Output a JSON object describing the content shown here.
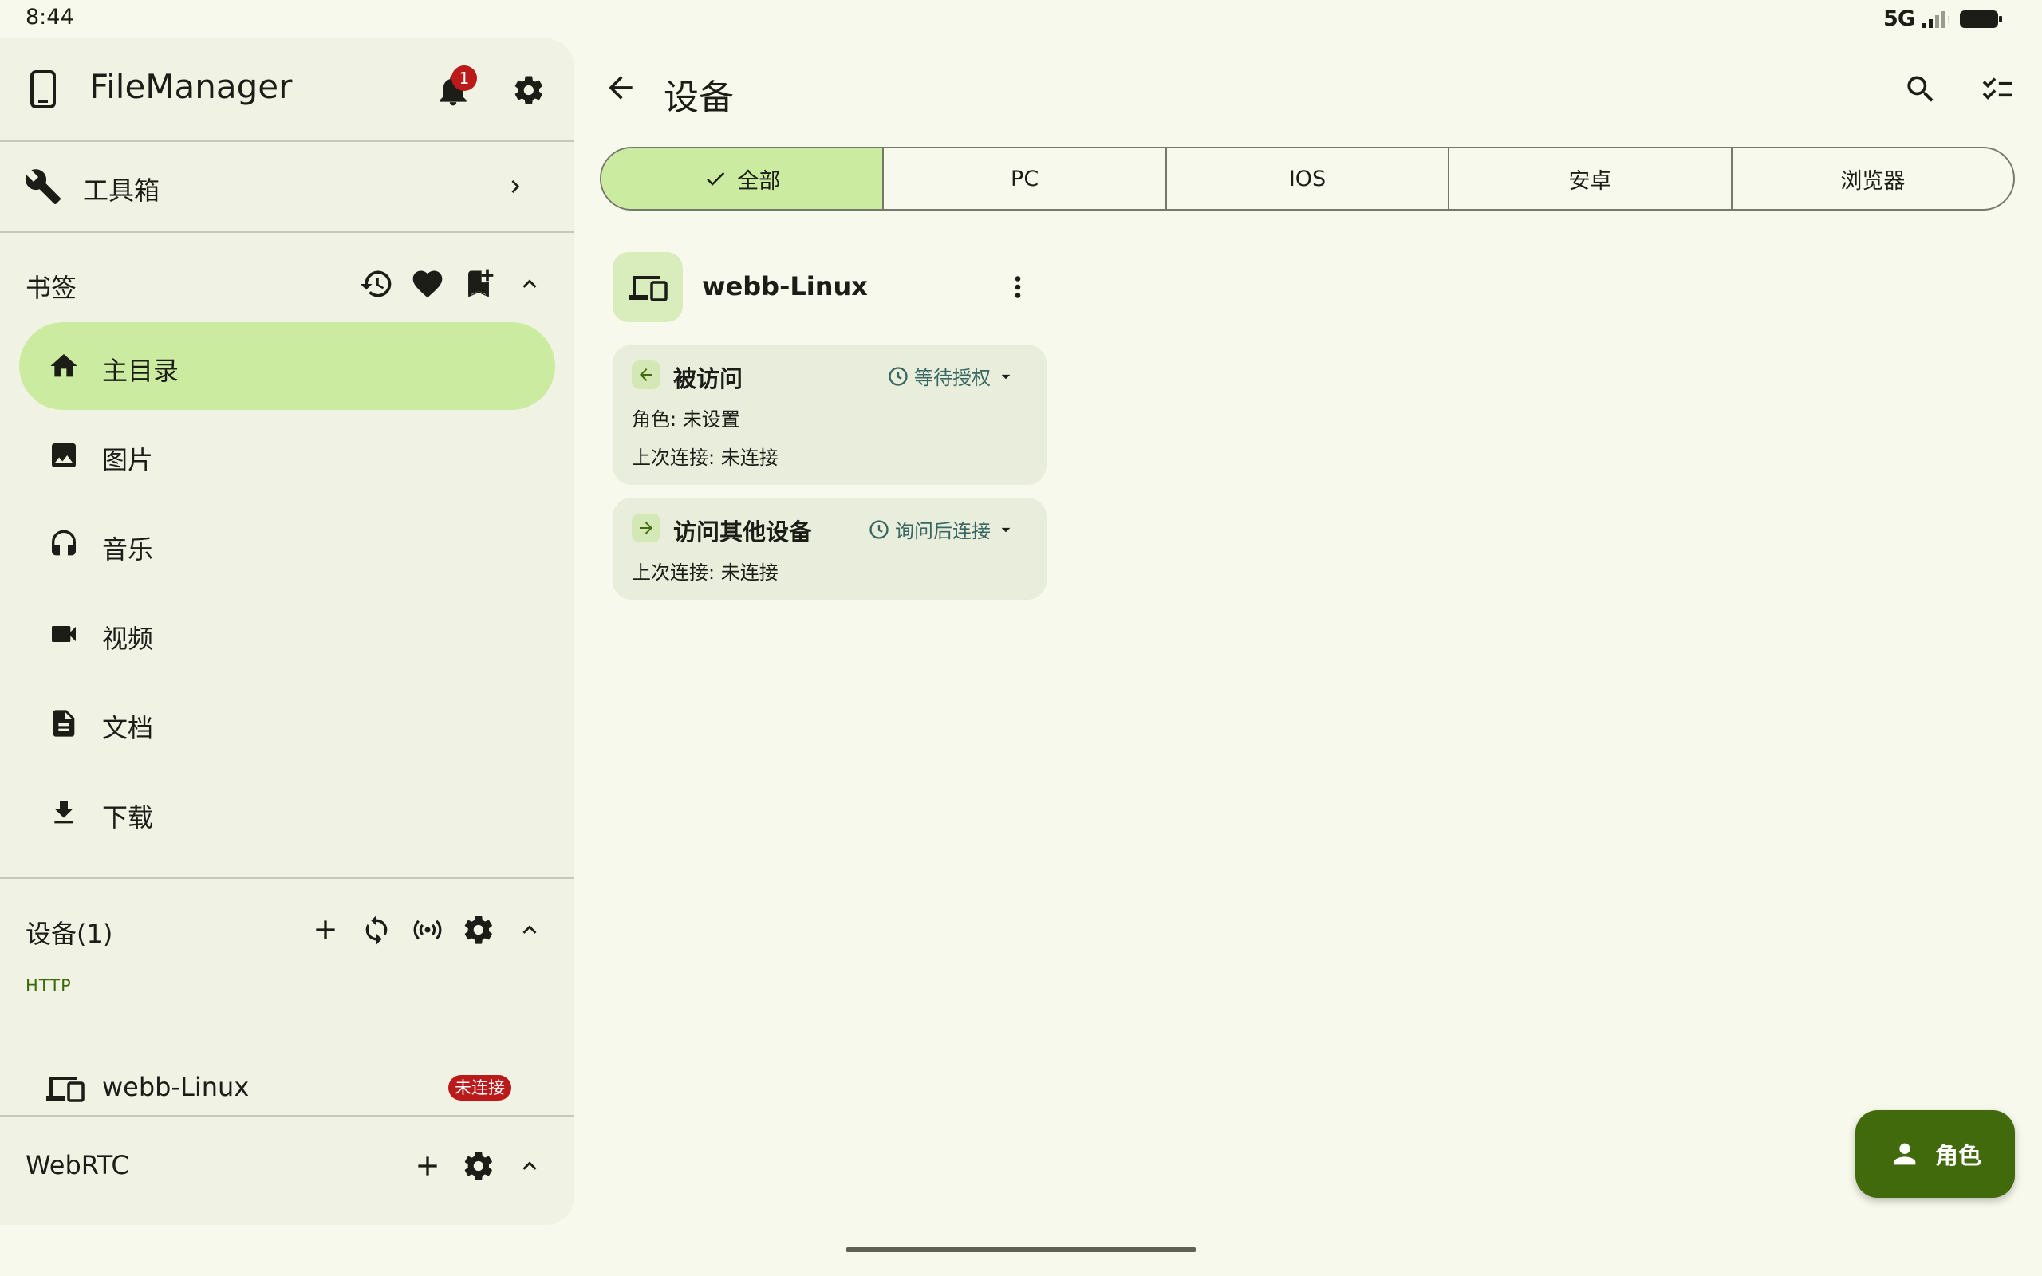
{
  "status_bar": {
    "time": "8:44",
    "network": "5G"
  },
  "drawer": {
    "app_title": "FileManager",
    "notification_count": "1",
    "toolbox_label": "工具箱",
    "bookmarks": {
      "title": "书签",
      "items": [
        {
          "label": "主目录",
          "icon": "home-icon",
          "active": true
        },
        {
          "label": "图片",
          "icon": "image-icon"
        },
        {
          "label": "音乐",
          "icon": "headphones-icon"
        },
        {
          "label": "视频",
          "icon": "videocam-icon"
        },
        {
          "label": "文档",
          "icon": "document-icon"
        },
        {
          "label": "下载",
          "icon": "download-icon"
        }
      ]
    },
    "devices": {
      "title": "设备(1)",
      "group_label": "HTTP",
      "items": [
        {
          "name": "webb-Linux",
          "badge": "未连接"
        }
      ]
    },
    "webrtc": {
      "title": "WebRTC"
    }
  },
  "main": {
    "page_title": "设备",
    "filter_tabs": [
      "全部",
      "PC",
      "IOS",
      "安卓",
      "浏览器"
    ],
    "selected_tab": "全部",
    "device": {
      "name": "webb-Linux",
      "incoming": {
        "title": "被访问",
        "status": "等待授权",
        "role_line": "角色: 未设置",
        "last_connection": "上次连接: 未连接"
      },
      "outgoing": {
        "title": "访问其他设备",
        "status": "询问后连接",
        "last_connection": "上次连接: 未连接"
      }
    },
    "fab_label": "角色"
  },
  "colors": {
    "background": "#f7f9ec",
    "drawer": "#f0f2e4",
    "active": "#cbeba0",
    "fab": "#406a0c",
    "badge": "#ba1a1a",
    "status_text": "#386663"
  }
}
